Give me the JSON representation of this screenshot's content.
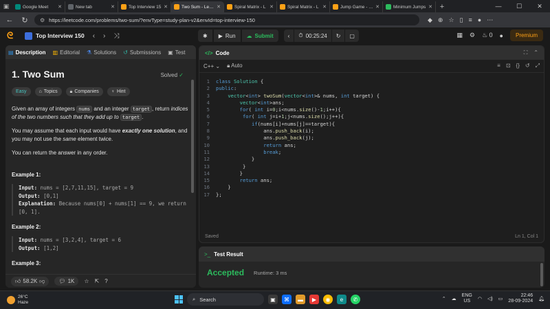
{
  "browser": {
    "tabs": [
      {
        "label": "Google Meet",
        "color": "#00897b",
        "active": false
      },
      {
        "label": "New tab",
        "color": "#5f6368",
        "active": false
      },
      {
        "label": "Top Interview 15",
        "color": "#ffa116",
        "active": false
      },
      {
        "label": "Two Sum - Leetc",
        "color": "#ffa116",
        "active": true
      },
      {
        "label": "Spiral Matrix - L",
        "color": "#ffa116",
        "active": false
      },
      {
        "label": "Spiral Matrix - L",
        "color": "#ffa116",
        "active": false
      },
      {
        "label": "Jump Game - Le",
        "color": "#ffa116",
        "active": false
      },
      {
        "label": "Minimum Jumps",
        "color": "#2cbb5d",
        "active": false
      }
    ],
    "url": "https://leetcode.com/problems/two-sum/?envType=study-plan-v2&envId=top-interview-150"
  },
  "nav": {
    "list_title": "Top Interview 150",
    "run_label": "Run",
    "submit_label": "Submit",
    "timer": "00:25:24",
    "streak": "0",
    "premium_label": "Premium"
  },
  "problem": {
    "tabs": [
      "Description",
      "Editorial",
      "Solutions",
      "Submissions",
      "Test"
    ],
    "title": "1. Two Sum",
    "status": "Solved",
    "tags": [
      "Easy",
      "Topics",
      "Companies",
      "Hint"
    ],
    "desc1_a": "Given an array of integers ",
    "desc1_code1": "nums",
    "desc1_b": " and an integer ",
    "desc1_code2": "target",
    "desc1_c": ", return ",
    "desc1_em": "indices of the two numbers such that they add up to",
    "desc1_code3": "target",
    "desc1_d": ".",
    "desc2_a": "You may assume that each input would have ",
    "desc2_strong": "exactly one solution",
    "desc2_b": ", and you may not use the ",
    "desc2_em": "same",
    "desc2_c": " element twice.",
    "desc3": "You can return the answer in any order.",
    "examples": [
      {
        "title": "Example 1:",
        "input_label": "Input:",
        "input": " nums = [2,7,11,15], target = 9",
        "output_label": "Output:",
        "output": " [0,1]",
        "explanation_label": "Explanation:",
        "explanation": " Because nums[0] + nums[1] == 9, we return [0, 1]."
      },
      {
        "title": "Example 2:",
        "input_label": "Input:",
        "input": " nums = [3,2,4], target = 6",
        "output_label": "Output:",
        "output": " [1,2]"
      },
      {
        "title": "Example 3:"
      }
    ],
    "likes": "58.2K",
    "comments": "1K"
  },
  "editor": {
    "header": "Code",
    "language": "C++",
    "mode": "Auto",
    "lines": [
      "class Solution {",
      "public:",
      "    vector<int> twoSum(vector<int>& nums, int target) {",
      "        vector<int>ans;",
      "        for( int i=0;i<nums.size()-1;i++){",
      "         for( int j=i+1;j<nums.size();j++){",
      "            if(nums[i]+nums[j]==target){",
      "                ans.push_back(i);",
      "                ans.push_back(j);",
      "                return ans;",
      "                break;",
      "            }",
      "         }",
      "        }",
      "        return ans;",
      "    }",
      "};"
    ],
    "saved": "Saved",
    "cursor": "Ln 1, Col 1"
  },
  "result": {
    "header": "Test Result",
    "status": "Accepted",
    "runtime": "Runtime: 3 ms"
  },
  "taskbar": {
    "temp": "26°C",
    "weather": "Haze",
    "search": "Search",
    "lang1": "ENG",
    "lang2": "US",
    "time": "22:46",
    "date": "28-09-2024"
  }
}
